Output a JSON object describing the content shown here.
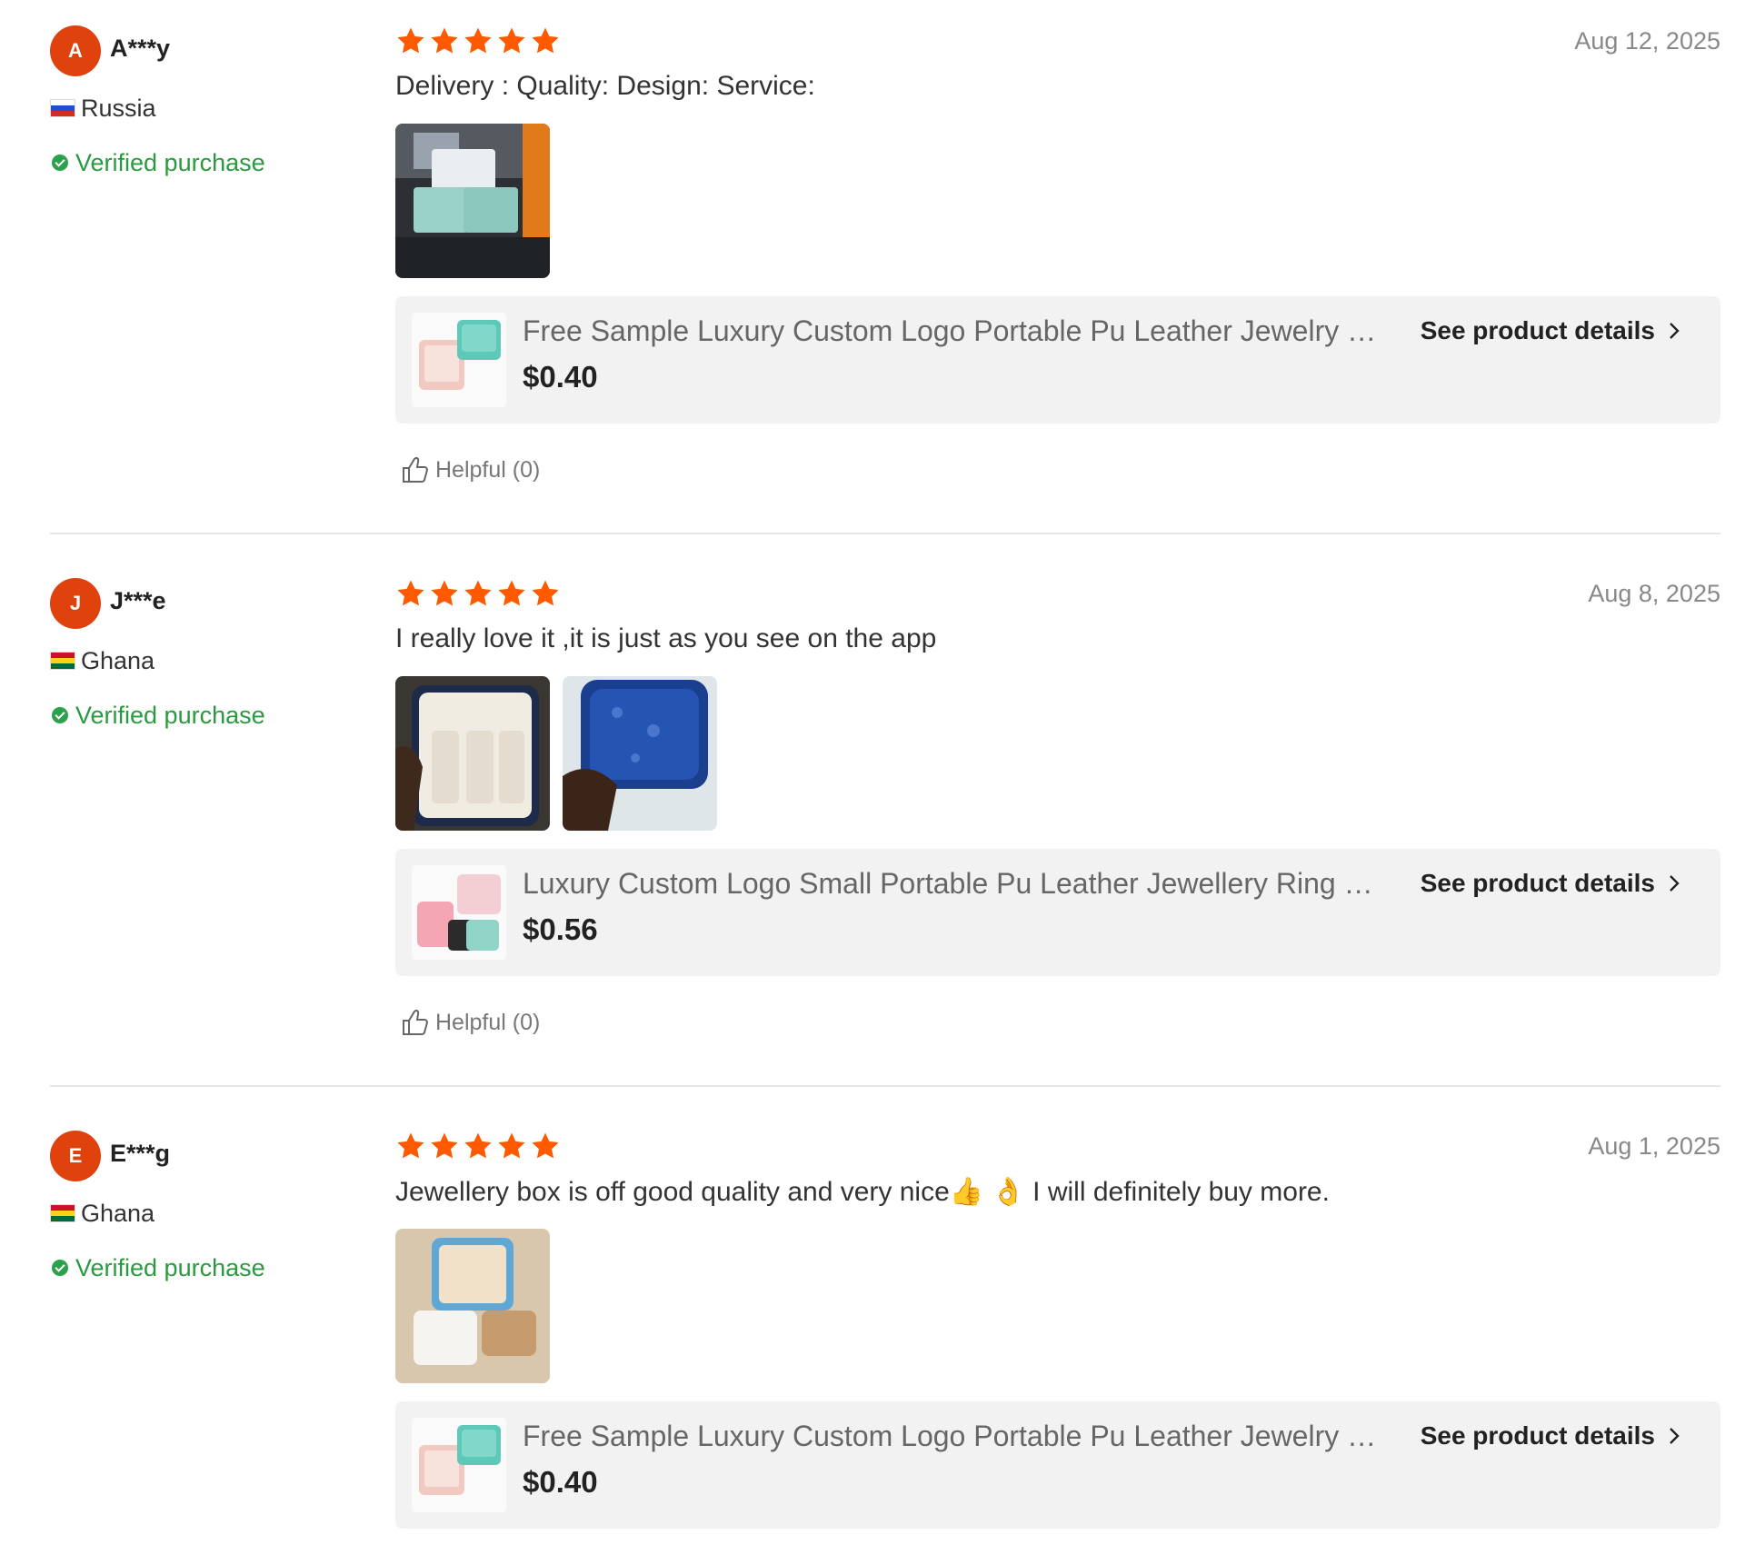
{
  "star_color": "#ff5a00",
  "avatar_color": "#e0420e",
  "verified_color": "#2a9a3e",
  "reviews": [
    {
      "initial": "A",
      "name": "A***y",
      "country": "Russia",
      "flag": "flag-russia",
      "verified": "Verified purchase",
      "rating": 5,
      "date": "Aug 12, 2025",
      "text": "Delivery :  Quality:  Design:  Service:",
      "photo_count": 1,
      "product": {
        "title": "Free Sample Luxury Custom Logo Portable Pu Leather Jewelry Box",
        "price": "$0.40",
        "details_label": "See product details"
      },
      "helpful": "Helpful (0)"
    },
    {
      "initial": "J",
      "name": "J***e",
      "country": "Ghana",
      "flag": "flag-ghana",
      "verified": "Verified purchase",
      "rating": 5,
      "date": "Aug 8, 2025",
      "text": "I really love it ,it is just as you see on the app",
      "photo_count": 2,
      "product": {
        "title": "Luxury Custom Logo Small Portable Pu Leather Jewellery Ring Box",
        "price": "$0.56",
        "details_label": "See product details"
      },
      "helpful": "Helpful (0)"
    },
    {
      "initial": "E",
      "name": "E***g",
      "country": "Ghana",
      "flag": "flag-ghana",
      "verified": "Verified purchase",
      "rating": 5,
      "date": "Aug 1, 2025",
      "text": "Jewellery box is off good quality and very nice👍 👌 I will definitely buy more.",
      "photo_count": 1,
      "product": {
        "title": "Free Sample Luxury Custom Logo Portable Pu Leather Jewelry Box",
        "price": "$0.40",
        "details_label": "See product details"
      }
    }
  ]
}
